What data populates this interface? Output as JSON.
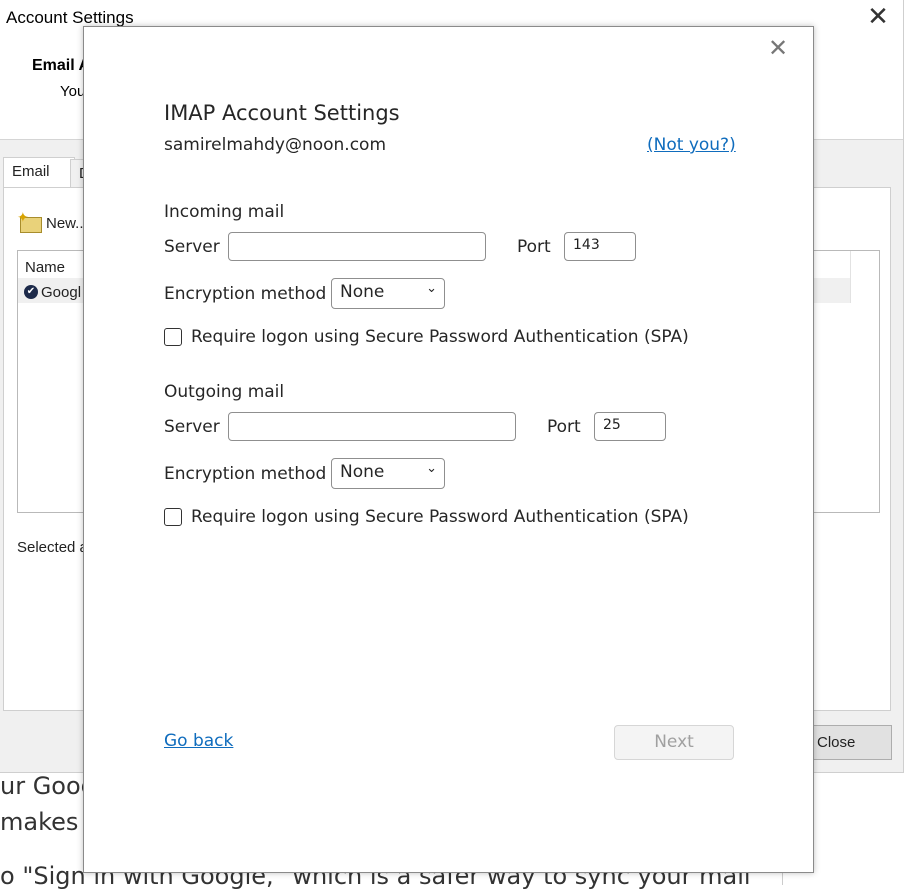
{
  "background": {
    "line1": "ur Goog",
    "line2": " makes",
    "line3": "o \"Sign in with Google,\" which is a safer way to sync your mail"
  },
  "account_window": {
    "title": "Account Settings",
    "close_glyph": "✕",
    "heading": "Email A",
    "subheading": "You",
    "tabs": [
      "Email",
      "D"
    ],
    "toolbar": {
      "new_label": "New..."
    },
    "list": {
      "column_name": "Name",
      "rows": [
        {
          "name": "Googl"
        }
      ]
    },
    "selected_text": "Selected a",
    "close_button": "Close"
  },
  "imap_dialog": {
    "close_glyph": "✕",
    "title": "IMAP Account Settings",
    "email": "samirelmahdy@noon.com",
    "not_you": "(Not you?)",
    "incoming": {
      "section_label": "Incoming mail",
      "server_label": "Server",
      "server_value": "",
      "port_label": "Port",
      "port_value": "143",
      "encryption_label": "Encryption method",
      "encryption_value": "None",
      "spa_label": "Require logon using Secure Password Authentication (SPA)",
      "spa_checked": false
    },
    "outgoing": {
      "section_label": "Outgoing mail",
      "server_label": "Server",
      "server_value": "",
      "port_label": "Port",
      "port_value": "25",
      "encryption_label": "Encryption method",
      "encryption_value": "None",
      "spa_label": "Require logon using Secure Password Authentication (SPA)",
      "spa_checked": false
    },
    "go_back": "Go back",
    "next": "Next"
  },
  "colors": {
    "link": "#0f6cbd",
    "disabled_text": "#a0a0a0"
  }
}
